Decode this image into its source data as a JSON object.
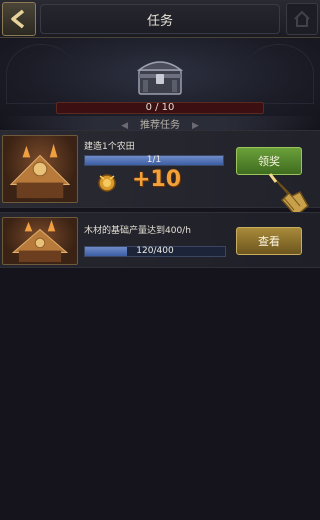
{
  "header": {
    "title": "任务",
    "back_icon": "back-arrow-icon"
  },
  "chest": {
    "progress_text": "0 / 10",
    "progress_fraction": 0.0,
    "icon": "treasure-chest-icon"
  },
  "section": {
    "label": "推荐任务"
  },
  "tasks": [
    {
      "name": "建造1个农田",
      "progress_text": "1/1",
      "progress_fraction": 1.0,
      "reward_icon": "gold-coin-icon",
      "reward_amount": "+10",
      "button_label": "领奖",
      "button_color": "#4f8a2a"
    },
    {
      "name": "木材的基础产量达到400/h",
      "progress_text": "120/400",
      "progress_fraction": 0.3,
      "button_label": "查看",
      "button_color": "#8c7028"
    }
  ],
  "colors": {
    "background": "#15141d",
    "reward_text": "#f2a03a",
    "progress_fill": "#4f6fb3"
  }
}
